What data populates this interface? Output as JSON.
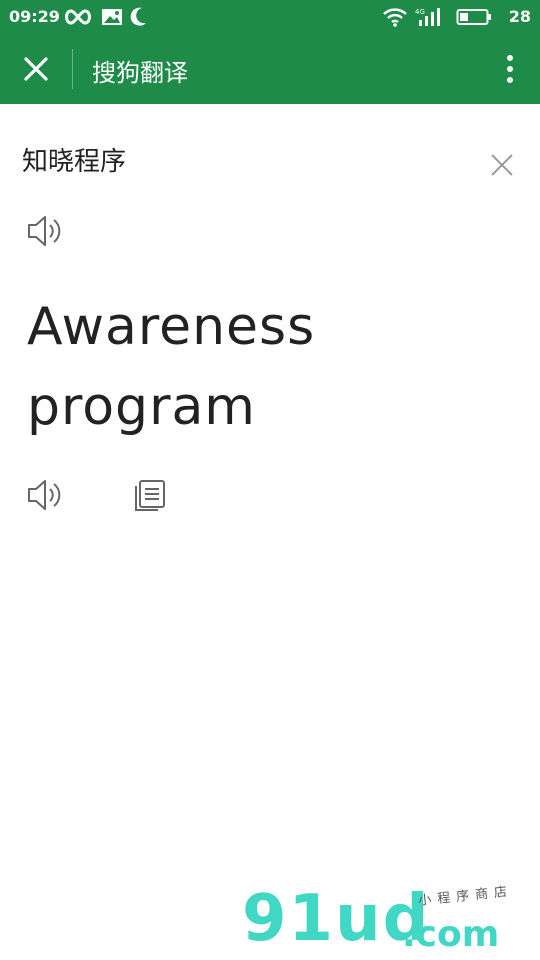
{
  "status_bar": {
    "time": "09:29",
    "battery_level": "28",
    "left_icons": [
      "infinity-icon",
      "image-icon",
      "moon-icon"
    ],
    "right_icons": [
      "wifi-icon",
      "signal-4g-icon",
      "battery-icon"
    ],
    "network_label": "4G"
  },
  "app_bar": {
    "title": "搜狗翻译",
    "close_icon": "close-icon",
    "more_icon": "more-vertical-icon",
    "color": "#1e8b48"
  },
  "translation": {
    "source_text": "知晓程序",
    "result_text": "Awareness program"
  },
  "watermark": {
    "main": "91ud",
    "domain": ".com",
    "subtitle": "小程序商店"
  }
}
